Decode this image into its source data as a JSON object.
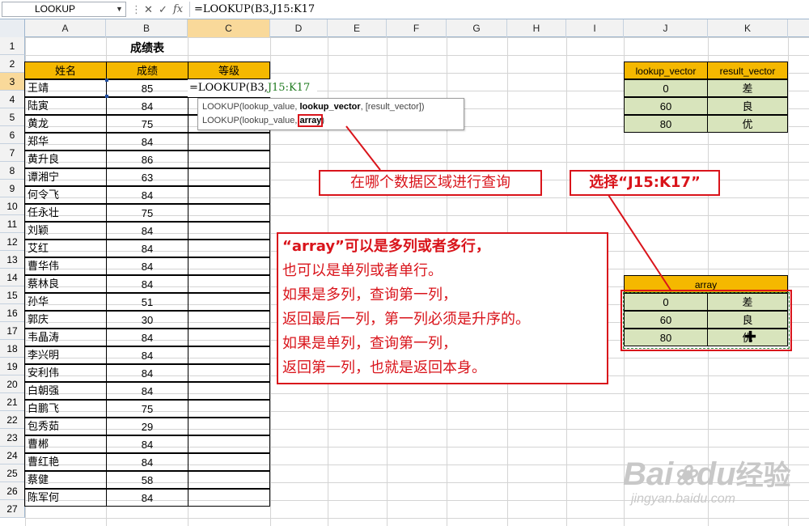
{
  "formula_bar": {
    "name_box": "LOOKUP",
    "cancel_icon": "✕",
    "enter_icon": "✓",
    "fx_label": "fx",
    "formula": "=LOOKUP(B3,J15:K17"
  },
  "columns": [
    "A",
    "B",
    "C",
    "D",
    "E",
    "F",
    "G",
    "H",
    "I",
    "J",
    "K"
  ],
  "rows": [
    "1",
    "2",
    "3",
    "4",
    "5",
    "6",
    "7",
    "8",
    "9",
    "10",
    "11",
    "12",
    "13",
    "14",
    "15",
    "16",
    "17",
    "18",
    "19",
    "20",
    "21",
    "22",
    "23",
    "24",
    "25",
    "26",
    "27"
  ],
  "sheet": {
    "title": "成绩表",
    "headers": {
      "name": "姓名",
      "score": "成绩",
      "grade": "等级"
    },
    "records": [
      {
        "name": "王靖",
        "score": "85"
      },
      {
        "name": "陆寅",
        "score": "84"
      },
      {
        "name": "黄龙",
        "score": "75"
      },
      {
        "name": "郑华",
        "score": "84"
      },
      {
        "name": "黄升良",
        "score": "86"
      },
      {
        "name": "谭湘宁",
        "score": "63"
      },
      {
        "name": "何令飞",
        "score": "84"
      },
      {
        "name": "任永壮",
        "score": "75"
      },
      {
        "name": "刘颖",
        "score": "84"
      },
      {
        "name": "艾红",
        "score": "84"
      },
      {
        "name": "曹华伟",
        "score": "84"
      },
      {
        "name": "蔡林良",
        "score": "84"
      },
      {
        "name": "孙华",
        "score": "51"
      },
      {
        "name": "郭庆",
        "score": "30"
      },
      {
        "name": "韦晶涛",
        "score": "84"
      },
      {
        "name": "李兴明",
        "score": "84"
      },
      {
        "name": "安利伟",
        "score": "84"
      },
      {
        "name": "白朝强",
        "score": "84"
      },
      {
        "name": "白鹏飞",
        "score": "75"
      },
      {
        "name": "包秀茹",
        "score": "29"
      },
      {
        "name": "曹郴",
        "score": "84"
      },
      {
        "name": "曹红艳",
        "score": "84"
      },
      {
        "name": "蔡健",
        "score": "58"
      },
      {
        "name": "陈军何",
        "score": "84"
      }
    ],
    "editing_cell": {
      "prefix": "=LOOKUP(B3,",
      "ref": "J15:K17"
    }
  },
  "tooltip": {
    "line1": {
      "pre": "LOOKUP(lookup_value, ",
      "bold": "lookup_vector",
      "post": ", [result_vector])"
    },
    "line2": {
      "pre": "LOOKUP(lookup_value, ",
      "bold": "array",
      "post": ")"
    }
  },
  "vector_table": {
    "headers": [
      "lookup_vector",
      "result_vector"
    ],
    "rows": [
      [
        "0",
        "差"
      ],
      [
        "60",
        "良"
      ],
      [
        "80",
        "优"
      ]
    ]
  },
  "array_table": {
    "header": "array",
    "rows": [
      [
        "0",
        "差"
      ],
      [
        "60",
        "良"
      ],
      [
        "80",
        "优"
      ]
    ]
  },
  "callouts": {
    "query_area": "在哪个数据区域进行查询",
    "select_range": "选择“J15:K17”",
    "explanation": [
      "“array”可以是多列或者多行，",
      "也可以是单列或者单行。",
      "如果是多列，查询第一列，",
      "返回最后一列，第一列必须是升序的。",
      "如果是单列，查询第一列，",
      "返回第一列，也就是返回本身。"
    ]
  },
  "watermark": {
    "brand": "Bai",
    "brand2": "du",
    "cn": "经验",
    "url": "jingyan.baidu.com"
  },
  "colors": {
    "header_orange": "#f5b800",
    "table_green": "#d8e4bc",
    "callout_red": "#d9141b"
  }
}
